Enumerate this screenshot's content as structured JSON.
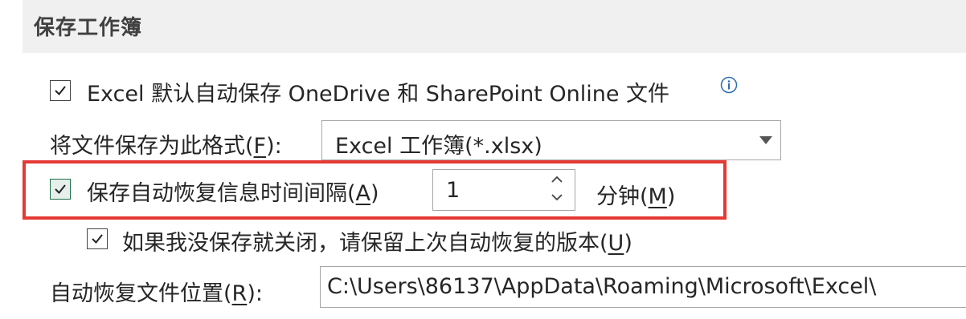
{
  "section": {
    "title": "保存工作簿"
  },
  "autosave": {
    "label": "Excel 默认自动保存 OneDrive 和 SharePoint Online 文件",
    "checked": true,
    "info_icon": "info-icon"
  },
  "format": {
    "label_prefix": "将文件保存为此格式(",
    "label_key": "F",
    "label_suffix": "):",
    "value": "Excel 工作簿(*.xlsx)"
  },
  "autorecover": {
    "label_prefix": "保存自动恢复信息时间间隔(",
    "label_key": "A",
    "label_suffix": ")",
    "checked": true,
    "value": "1",
    "unit_prefix": "分钟(",
    "unit_key": "M",
    "unit_suffix": ")",
    "highlight_color": "#e53935"
  },
  "keep_last": {
    "label_prefix": "如果我没保存就关闭，请保留上次自动恢复的版本(",
    "label_key": "U",
    "label_suffix": ")",
    "checked": true
  },
  "location": {
    "label_prefix": "自动恢复文件位置(",
    "label_key": "R",
    "label_suffix": "):",
    "value": "C:\\Users\\86137\\AppData\\Roaming\\Microsoft\\Excel\\"
  }
}
